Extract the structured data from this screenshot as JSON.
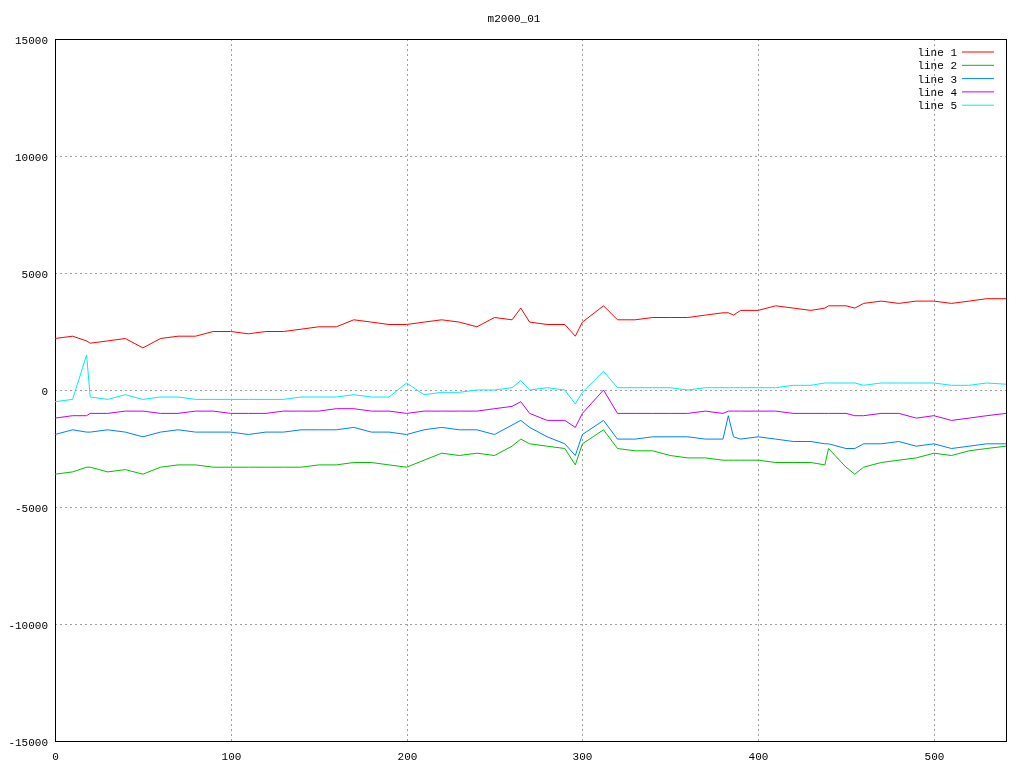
{
  "plot": {
    "chart_data": {
      "type": "line",
      "title": "m2000_01",
      "x": [
        0,
        10,
        18,
        20,
        30,
        40,
        50,
        60,
        70,
        80,
        90,
        100,
        110,
        120,
        130,
        140,
        150,
        160,
        170,
        180,
        190,
        200,
        210,
        220,
        230,
        240,
        250,
        260,
        265,
        270,
        280,
        290,
        296,
        300,
        312,
        320,
        330,
        340,
        350,
        360,
        370,
        380,
        383,
        386,
        390,
        400,
        410,
        420,
        430,
        438,
        440,
        450,
        455,
        460,
        470,
        480,
        490,
        500,
        510,
        520,
        530,
        541
      ],
      "xlim": [
        0,
        541
      ],
      "ylim": [
        -15000,
        15000
      ],
      "xticks": [
        0,
        100,
        200,
        300,
        400,
        500
      ],
      "yticks": [
        -15000,
        -10000,
        -5000,
        0,
        5000,
        10000,
        15000
      ],
      "grid": true,
      "legend": true,
      "series": [
        {
          "name": "line 1",
          "color": "#ff0000",
          "values": [
            2200,
            2300,
            2100,
            2000,
            2100,
            2200,
            1800,
            2200,
            2300,
            2300,
            2500,
            2500,
            2400,
            2500,
            2500,
            2600,
            2700,
            2700,
            3000,
            2900,
            2800,
            2800,
            2900,
            3000,
            2900,
            2700,
            3100,
            3000,
            3500,
            2900,
            2800,
            2800,
            2300,
            2900,
            3600,
            3000,
            3000,
            3100,
            3100,
            3100,
            3200,
            3300,
            3300,
            3200,
            3400,
            3400,
            3600,
            3500,
            3400,
            3500,
            3600,
            3600,
            3500,
            3700,
            3800,
            3700,
            3800,
            3800,
            3700,
            3800,
            3900,
            3900
          ]
        },
        {
          "name": "line 2",
          "color": "#00c000",
          "values": [
            -3600,
            -3500,
            -3300,
            -3300,
            -3500,
            -3400,
            -3600,
            -3300,
            -3200,
            -3200,
            -3300,
            -3300,
            -3300,
            -3300,
            -3300,
            -3300,
            -3200,
            -3200,
            -3100,
            -3100,
            -3200,
            -3300,
            -3000,
            -2700,
            -2800,
            -2700,
            -2800,
            -2400,
            -2100,
            -2300,
            -2400,
            -2500,
            -3200,
            -2300,
            -1700,
            -2500,
            -2600,
            -2600,
            -2800,
            -2900,
            -2900,
            -3000,
            -3000,
            -3000,
            -3000,
            -3000,
            -3100,
            -3100,
            -3100,
            -3200,
            -2500,
            -3300,
            -3600,
            -3300,
            -3100,
            -3000,
            -2900,
            -2700,
            -2800,
            -2600,
            -2500,
            -2400
          ]
        },
        {
          "name": "line 3",
          "color": "#0080ff",
          "values": [
            -1900,
            -1700,
            -1800,
            -1800,
            -1700,
            -1800,
            -2000,
            -1800,
            -1700,
            -1800,
            -1800,
            -1800,
            -1900,
            -1800,
            -1800,
            -1700,
            -1700,
            -1700,
            -1600,
            -1800,
            -1800,
            -1900,
            -1700,
            -1600,
            -1700,
            -1700,
            -1900,
            -1500,
            -1300,
            -1600,
            -2000,
            -2300,
            -2800,
            -1900,
            -1300,
            -2100,
            -2100,
            -2000,
            -2000,
            -2000,
            -2100,
            -2100,
            -1100,
            -2000,
            -2100,
            -2000,
            -2100,
            -2200,
            -2200,
            -2300,
            -2300,
            -2500,
            -2500,
            -2300,
            -2300,
            -2200,
            -2400,
            -2300,
            -2500,
            -2400,
            -2300,
            -2300
          ]
        },
        {
          "name": "line 4",
          "color": "#c000ff",
          "values": [
            -1200,
            -1100,
            -1100,
            -1000,
            -1000,
            -900,
            -900,
            -1000,
            -1000,
            -900,
            -900,
            -1000,
            -1000,
            -1000,
            -900,
            -900,
            -900,
            -800,
            -800,
            -900,
            -900,
            -1000,
            -900,
            -900,
            -900,
            -900,
            -800,
            -700,
            -500,
            -1000,
            -1300,
            -1300,
            -1600,
            -1000,
            0,
            -1000,
            -1000,
            -1000,
            -1000,
            -1000,
            -900,
            -1000,
            -900,
            -900,
            -900,
            -900,
            -900,
            -1000,
            -1000,
            -1000,
            -1000,
            -1000,
            -1100,
            -1100,
            -1000,
            -1000,
            -1200,
            -1100,
            -1300,
            -1200,
            -1100,
            -1000
          ]
        },
        {
          "name": "line 5",
          "color": "#00eeee",
          "values": [
            -500,
            -400,
            1500,
            -300,
            -400,
            -200,
            -400,
            -300,
            -300,
            -400,
            -400,
            -400,
            -400,
            -400,
            -400,
            -300,
            -300,
            -300,
            -200,
            -300,
            -300,
            300,
            -200,
            -100,
            -100,
            0,
            0,
            100,
            400,
            0,
            100,
            0,
            -600,
            -100,
            800,
            100,
            100,
            100,
            100,
            0,
            100,
            100,
            100,
            100,
            100,
            100,
            100,
            200,
            200,
            300,
            300,
            300,
            300,
            200,
            300,
            300,
            300,
            300,
            200,
            200,
            300,
            250
          ]
        }
      ]
    }
  }
}
